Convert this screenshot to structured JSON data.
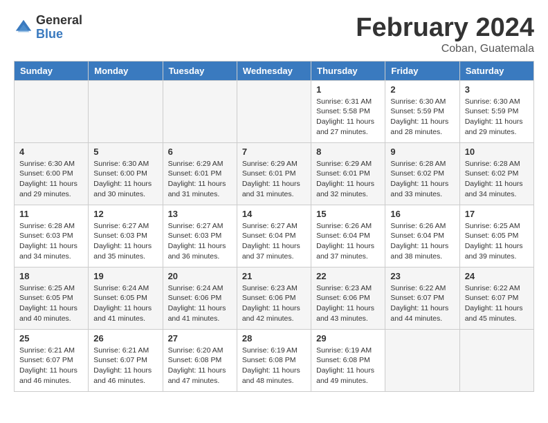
{
  "logo": {
    "general": "General",
    "blue": "Blue"
  },
  "title": "February 2024",
  "location": "Coban, Guatemala",
  "days_of_week": [
    "Sunday",
    "Monday",
    "Tuesday",
    "Wednesday",
    "Thursday",
    "Friday",
    "Saturday"
  ],
  "weeks": [
    [
      {
        "day": "",
        "info": ""
      },
      {
        "day": "",
        "info": ""
      },
      {
        "day": "",
        "info": ""
      },
      {
        "day": "",
        "info": ""
      },
      {
        "day": "1",
        "info": "Sunrise: 6:31 AM\nSunset: 5:58 PM\nDaylight: 11 hours\nand 27 minutes."
      },
      {
        "day": "2",
        "info": "Sunrise: 6:30 AM\nSunset: 5:59 PM\nDaylight: 11 hours\nand 28 minutes."
      },
      {
        "day": "3",
        "info": "Sunrise: 6:30 AM\nSunset: 5:59 PM\nDaylight: 11 hours\nand 29 minutes."
      }
    ],
    [
      {
        "day": "4",
        "info": "Sunrise: 6:30 AM\nSunset: 6:00 PM\nDaylight: 11 hours\nand 29 minutes."
      },
      {
        "day": "5",
        "info": "Sunrise: 6:30 AM\nSunset: 6:00 PM\nDaylight: 11 hours\nand 30 minutes."
      },
      {
        "day": "6",
        "info": "Sunrise: 6:29 AM\nSunset: 6:01 PM\nDaylight: 11 hours\nand 31 minutes."
      },
      {
        "day": "7",
        "info": "Sunrise: 6:29 AM\nSunset: 6:01 PM\nDaylight: 11 hours\nand 31 minutes."
      },
      {
        "day": "8",
        "info": "Sunrise: 6:29 AM\nSunset: 6:01 PM\nDaylight: 11 hours\nand 32 minutes."
      },
      {
        "day": "9",
        "info": "Sunrise: 6:28 AM\nSunset: 6:02 PM\nDaylight: 11 hours\nand 33 minutes."
      },
      {
        "day": "10",
        "info": "Sunrise: 6:28 AM\nSunset: 6:02 PM\nDaylight: 11 hours\nand 34 minutes."
      }
    ],
    [
      {
        "day": "11",
        "info": "Sunrise: 6:28 AM\nSunset: 6:03 PM\nDaylight: 11 hours\nand 34 minutes."
      },
      {
        "day": "12",
        "info": "Sunrise: 6:27 AM\nSunset: 6:03 PM\nDaylight: 11 hours\nand 35 minutes."
      },
      {
        "day": "13",
        "info": "Sunrise: 6:27 AM\nSunset: 6:03 PM\nDaylight: 11 hours\nand 36 minutes."
      },
      {
        "day": "14",
        "info": "Sunrise: 6:27 AM\nSunset: 6:04 PM\nDaylight: 11 hours\nand 37 minutes."
      },
      {
        "day": "15",
        "info": "Sunrise: 6:26 AM\nSunset: 6:04 PM\nDaylight: 11 hours\nand 37 minutes."
      },
      {
        "day": "16",
        "info": "Sunrise: 6:26 AM\nSunset: 6:04 PM\nDaylight: 11 hours\nand 38 minutes."
      },
      {
        "day": "17",
        "info": "Sunrise: 6:25 AM\nSunset: 6:05 PM\nDaylight: 11 hours\nand 39 minutes."
      }
    ],
    [
      {
        "day": "18",
        "info": "Sunrise: 6:25 AM\nSunset: 6:05 PM\nDaylight: 11 hours\nand 40 minutes."
      },
      {
        "day": "19",
        "info": "Sunrise: 6:24 AM\nSunset: 6:05 PM\nDaylight: 11 hours\nand 41 minutes."
      },
      {
        "day": "20",
        "info": "Sunrise: 6:24 AM\nSunset: 6:06 PM\nDaylight: 11 hours\nand 41 minutes."
      },
      {
        "day": "21",
        "info": "Sunrise: 6:23 AM\nSunset: 6:06 PM\nDaylight: 11 hours\nand 42 minutes."
      },
      {
        "day": "22",
        "info": "Sunrise: 6:23 AM\nSunset: 6:06 PM\nDaylight: 11 hours\nand 43 minutes."
      },
      {
        "day": "23",
        "info": "Sunrise: 6:22 AM\nSunset: 6:07 PM\nDaylight: 11 hours\nand 44 minutes."
      },
      {
        "day": "24",
        "info": "Sunrise: 6:22 AM\nSunset: 6:07 PM\nDaylight: 11 hours\nand 45 minutes."
      }
    ],
    [
      {
        "day": "25",
        "info": "Sunrise: 6:21 AM\nSunset: 6:07 PM\nDaylight: 11 hours\nand 46 minutes."
      },
      {
        "day": "26",
        "info": "Sunrise: 6:21 AM\nSunset: 6:07 PM\nDaylight: 11 hours\nand 46 minutes."
      },
      {
        "day": "27",
        "info": "Sunrise: 6:20 AM\nSunset: 6:08 PM\nDaylight: 11 hours\nand 47 minutes."
      },
      {
        "day": "28",
        "info": "Sunrise: 6:19 AM\nSunset: 6:08 PM\nDaylight: 11 hours\nand 48 minutes."
      },
      {
        "day": "29",
        "info": "Sunrise: 6:19 AM\nSunset: 6:08 PM\nDaylight: 11 hours\nand 49 minutes."
      },
      {
        "day": "",
        "info": ""
      },
      {
        "day": "",
        "info": ""
      }
    ]
  ]
}
